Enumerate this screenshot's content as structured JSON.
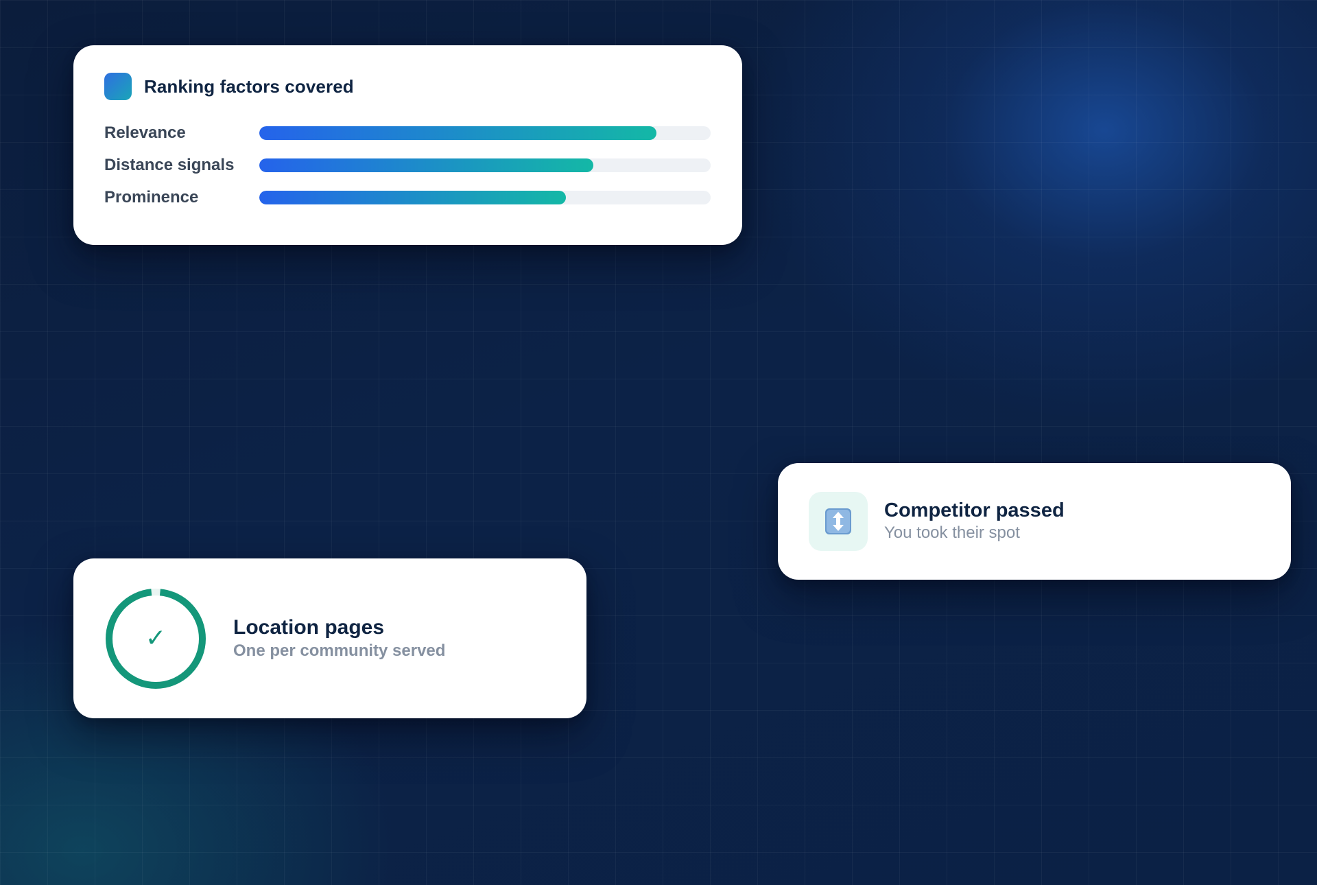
{
  "colors": {
    "card_title": "#0f2442",
    "label": "#3a4657",
    "muted": "#8590a0",
    "bar_start": "#2563eb",
    "bar_end": "#14b8a6",
    "ring": "#14977a",
    "background": "#0c2247"
  },
  "ranking_card": {
    "title": "Ranking factors covered",
    "badge_icon": "gradient-square-icon",
    "factors": [
      {
        "label": "Relevance",
        "progress": 0.88
      },
      {
        "label": "Distance signals",
        "progress": 0.74
      },
      {
        "label": "Prominence",
        "progress": 0.68
      }
    ]
  },
  "location_card": {
    "title": "Location pages",
    "subtitle": "One per community served",
    "ring_icon": "progress-ring-icon",
    "check_icon": "checkmark-icon",
    "check_glyph": "✓",
    "ring_progress": 0.97
  },
  "competitor_card": {
    "title": "Competitor passed",
    "subtitle": "You took their spot",
    "icon": "up-down-arrow-icon"
  }
}
